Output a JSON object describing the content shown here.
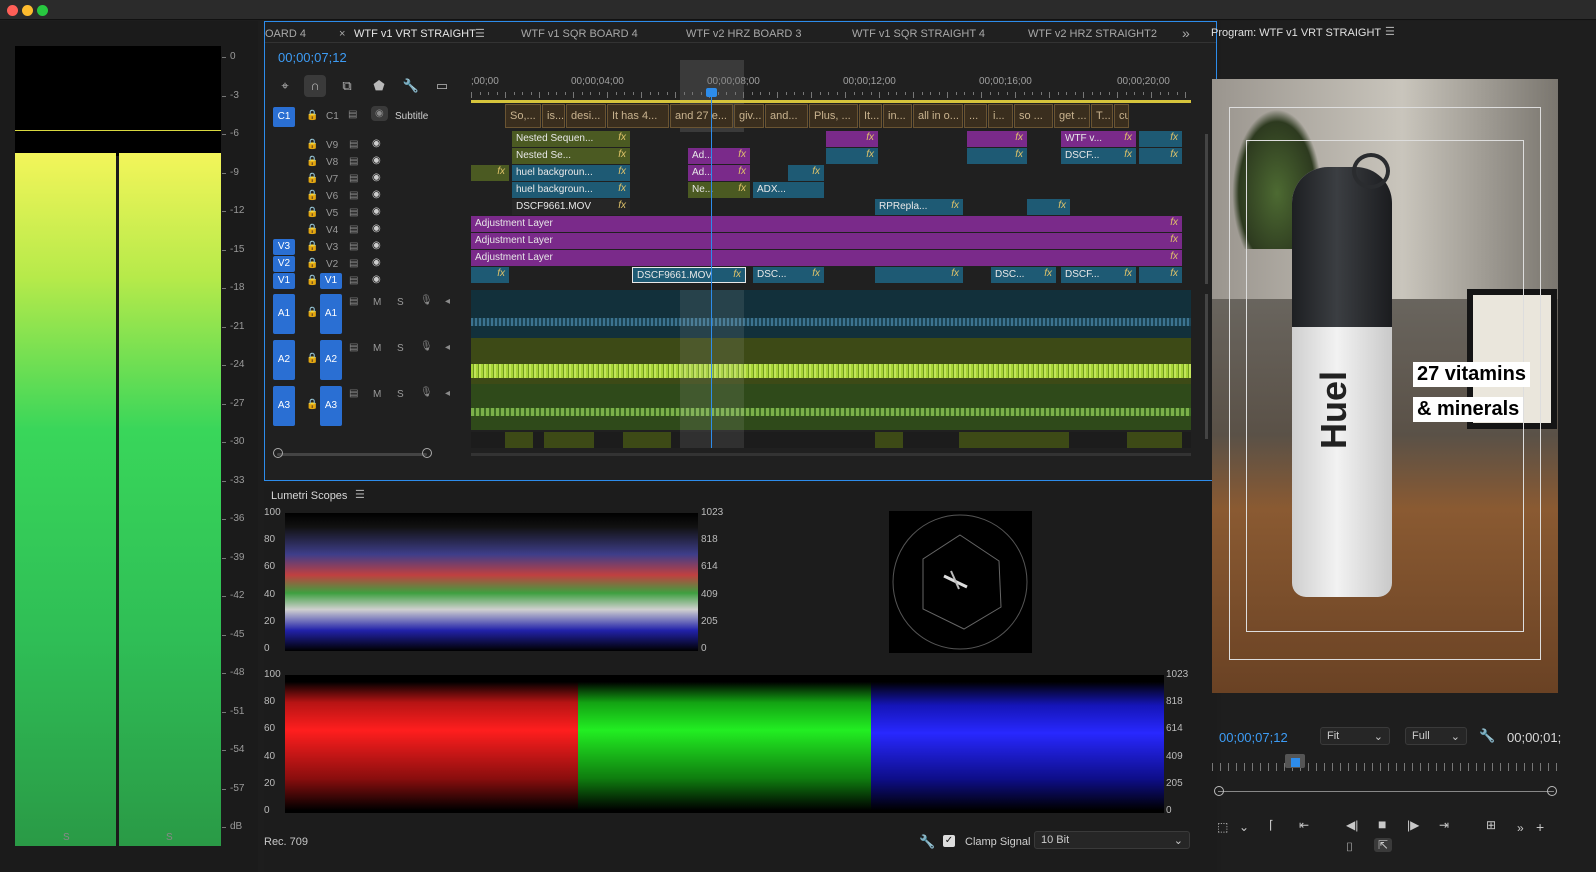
{
  "tabs": [
    {
      "label": "OARD 4"
    },
    {
      "label": "WTF v1 VRT STRAIGHT",
      "active": true
    },
    {
      "label": "WTF v1 SQR BOARD 4"
    },
    {
      "label": "WTF v2 HRZ  BOARD 3"
    },
    {
      "label": "WTF v1 SQR STRAIGHT 4"
    },
    {
      "label": "WTF v2 HRZ  STRAIGHT2"
    }
  ],
  "timeline": {
    "timecode": "00;00;07;12",
    "ruler_labels": [
      ";00;00",
      "00;00;04;00",
      "00;00;08;00",
      "00;00;12;00",
      "00;00;16;00",
      "00;00;20;00"
    ],
    "subtitle_label": "Subtitle",
    "subtitle_track": "C1",
    "subtitle_clips": [
      "So,...",
      "is...",
      "desi...",
      "It has 4...",
      "and 27 e...",
      "giv...",
      "and...",
      "Plus, ...",
      "It...",
      "in...",
      "all in o...",
      "...",
      "i...",
      "so ...",
      "get ...",
      "T...",
      "cu"
    ],
    "video_tracks": [
      "V9",
      "V8",
      "V7",
      "V6",
      "V5",
      "V4",
      "V3",
      "V2",
      "V1"
    ],
    "audio_tracks": [
      "A1",
      "A2",
      "A3"
    ],
    "clip_labels": {
      "v9_a": "Nested Sequen...",
      "v9_b": "WTF v...",
      "v8_a": "Nested Se...",
      "v8_b": "Ad...",
      "v8_c": "DSCF...",
      "v7_a": "huel backgroun...",
      "v7_b": "Ad...",
      "v6_a": "huel backgroun...",
      "v6_b": "Ne...",
      "v6_c": "ADX...",
      "v5_a": "DSCF9661.MOV",
      "v5_b": "RPRepla...",
      "adj": "Adjustment Layer",
      "v1_a": "DSCF9661.MOV",
      "v1_b": "DSC...",
      "v1_c": "DSC...",
      "v1_d": "DSCF..."
    },
    "fx": "fx",
    "mute": "M",
    "solo": "S"
  },
  "meter": {
    "scale": [
      "0",
      "-3",
      "-6",
      "-9",
      "-12",
      "-15",
      "-18",
      "-21",
      "-24",
      "-27",
      "-30",
      "-33",
      "-36",
      "-39",
      "-42",
      "-45",
      "-48",
      "-51",
      "-54",
      "-57",
      "dB"
    ],
    "solo_labels": [
      "S",
      "S"
    ]
  },
  "scopes": {
    "title": "Lumetri Scopes",
    "left_scale": [
      "100",
      "80",
      "60",
      "40",
      "20",
      "0"
    ],
    "right_scale": [
      "1023",
      "818",
      "614",
      "409",
      "205",
      "0"
    ],
    "color_space": "Rec. 709",
    "clamp_label": "Clamp Signal",
    "bit_depth": "10 Bit"
  },
  "program": {
    "title": "Program: WTF v1 VRT STRAIGHT",
    "timecode": "00;00;07;12",
    "fit": "Fit",
    "resolution": "Full",
    "duration": "00;00;01;",
    "caption_line1": "27 vitamins",
    "caption_line2": "& minerals",
    "product_brand": "Huel"
  },
  "colors": {
    "accent": "#2d8ceb",
    "video_clip": "#1e5a74",
    "audio_clip": "#4b5a22",
    "adjustment": "#7a2a8a"
  }
}
